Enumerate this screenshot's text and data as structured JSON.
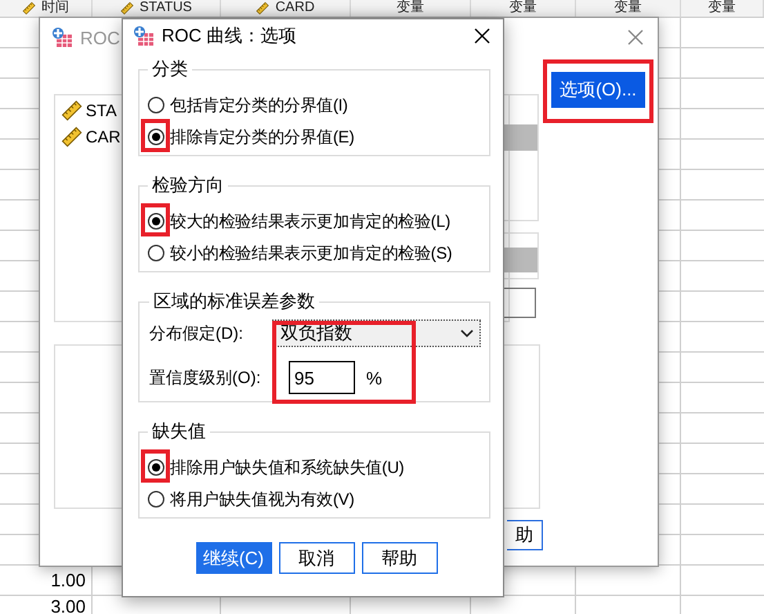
{
  "spreadsheet": {
    "columns": [
      {
        "label": "时间",
        "kind": "scale"
      },
      {
        "label": "STATUS",
        "kind": "scale"
      },
      {
        "label": "CARD",
        "kind": "scale"
      },
      {
        "label": "变量",
        "kind": "blank"
      },
      {
        "label": "变量",
        "kind": "blank"
      },
      {
        "label": "变量",
        "kind": "blank"
      },
      {
        "label": "变量",
        "kind": "blank"
      }
    ],
    "rows": [
      {
        "cells": [
          "1.00"
        ]
      },
      {
        "cells": [
          "3.00"
        ]
      }
    ]
  },
  "roc_dialog": {
    "title": "ROC",
    "variables": [
      {
        "name": "STA"
      },
      {
        "name": "CAR"
      }
    ],
    "options_button": {
      "label": "选项(O)...",
      "highlighted": true
    },
    "help_button": {
      "label": "助"
    }
  },
  "options_dialog": {
    "title": "ROC 曲线：选项",
    "groups": [
      {
        "title": "分类",
        "kind": "radios",
        "options": [
          {
            "label": "包括肯定分类的分界值(I)",
            "selected": false,
            "highlighted": false
          },
          {
            "label": "排除肯定分类的分界值(E)",
            "selected": true,
            "highlighted": true
          }
        ]
      },
      {
        "title": "检验方向",
        "kind": "radios",
        "options": [
          {
            "label": "较大的检验结果表示更加肯定的检验(L)",
            "selected": true,
            "highlighted": true
          },
          {
            "label": "较小的检验结果表示更加肯定的检验(S)",
            "selected": false,
            "highlighted": false
          }
        ]
      },
      {
        "title": "区域的标准误差参数",
        "kind": "fields",
        "highlighted": true,
        "distribution": {
          "label": "分布假定(D):",
          "value": "双负指数"
        },
        "confidence": {
          "label": "置信度级别(O):",
          "value": "95",
          "unit": "%"
        }
      },
      {
        "title": "缺失值",
        "kind": "radios",
        "options": [
          {
            "label": "排除用户缺失值和系统缺失值(U)",
            "selected": true,
            "highlighted": true
          },
          {
            "label": "将用户缺失值视为有效(V)",
            "selected": false,
            "highlighted": false
          }
        ]
      }
    ],
    "buttons": [
      {
        "label": "继续(C)",
        "primary": true
      },
      {
        "label": "取消",
        "primary": false
      },
      {
        "label": "帮助",
        "primary": false
      }
    ]
  }
}
